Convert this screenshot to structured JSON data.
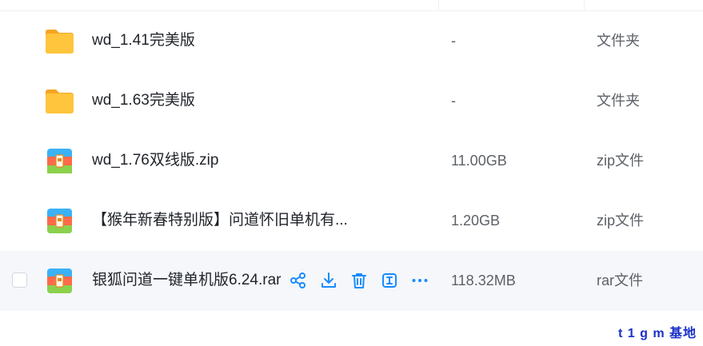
{
  "files": [
    {
      "name": "wd_1.41完美版",
      "size": "-",
      "type": "文件夹",
      "icon": "folder-icon"
    },
    {
      "name": "wd_1.63完美版",
      "size": "-",
      "type": "文件夹",
      "icon": "folder-icon"
    },
    {
      "name": "wd_1.76双线版.zip",
      "size": "11.00GB",
      "type": "zip文件",
      "icon": "archive-icon"
    },
    {
      "name": "【猴年新春特别版】问道怀旧单机有...",
      "size": "1.20GB",
      "type": "zip文件",
      "icon": "archive-icon"
    },
    {
      "name": "银狐问道一键单机版6.24.rar",
      "size": "118.32MB",
      "type": "rar文件",
      "icon": "archive-icon"
    }
  ],
  "row_actions": [
    "share-icon",
    "download-icon",
    "delete-icon",
    "rename-icon",
    "more-icon"
  ],
  "watermark": "t 1 g m 基地",
  "colors": {
    "accent": "#1a8cff",
    "folder": "#ffc53d",
    "hover_row": "#f5f7fb",
    "watermark": "#1a30c8"
  }
}
